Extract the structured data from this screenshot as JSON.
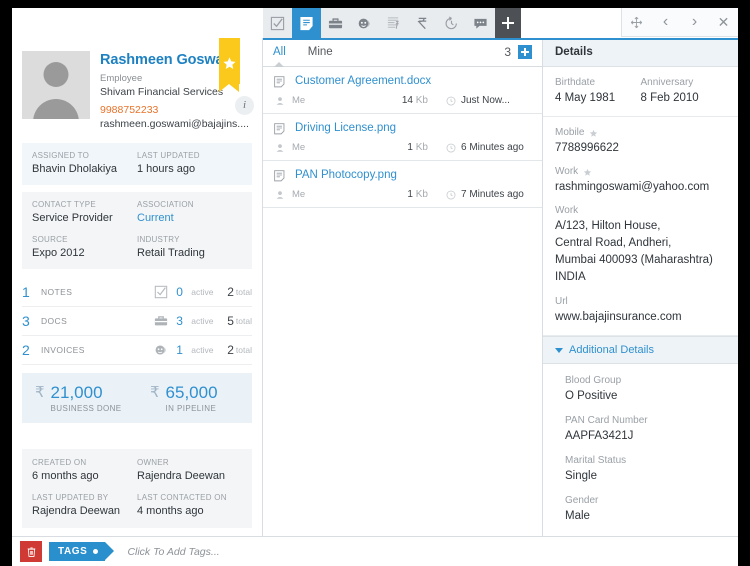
{
  "window_controls": [
    {
      "name": "move",
      "glyph": "move-icon"
    },
    {
      "name": "previous",
      "glyph": "‹"
    },
    {
      "name": "next",
      "glyph": "›"
    },
    {
      "name": "close",
      "glyph": "✕"
    }
  ],
  "toolbar": {
    "items": [
      {
        "name": "tasks-icon",
        "active": false
      },
      {
        "name": "notes-icon",
        "active": true
      },
      {
        "name": "deals-icon",
        "active": false
      },
      {
        "name": "contacts-icon",
        "active": false
      },
      {
        "name": "invoices-icon",
        "active": false
      },
      {
        "name": "payments-icon",
        "active": false
      },
      {
        "name": "history-icon",
        "active": false
      },
      {
        "name": "comments-icon",
        "active": false
      }
    ],
    "add_label": "+"
  },
  "profile": {
    "name": "Rashmeen Goswami",
    "role": "Employee",
    "company": "Shivam Financial Services",
    "phone": "9988752233",
    "email": "rashmeen.goswami@bajajins....",
    "favorite_icon": "star-icon",
    "info_icon": "info-icon"
  },
  "assigned_block": {
    "assigned_to_label": "ASSIGNED TO",
    "assigned_to_value": "Bhavin Dholakiya",
    "last_updated_label": "LAST UPDATED",
    "last_updated_value": "1 hours ago"
  },
  "contact_block": {
    "contact_type_label": "CONTACT TYPE",
    "contact_type_value": "Service Provider",
    "association_label": "ASSOCIATION",
    "association_value": "Current",
    "source_label": "SOURCE",
    "source_value": "Expo 2012",
    "industry_label": "INDUSTRY",
    "industry_value": "Retail Trading"
  },
  "stats": [
    {
      "count": "1",
      "label": "NOTES",
      "icon": "tasks-icon",
      "active": "0",
      "active_label": "active",
      "total": "2",
      "total_label": "total"
    },
    {
      "count": "3",
      "label": "DOCS",
      "icon": "deals-icon",
      "active": "3",
      "active_label": "active",
      "total": "5",
      "total_label": "total"
    },
    {
      "count": "2",
      "label": "INVOICES",
      "icon": "contacts-icon",
      "active": "1",
      "active_label": "active",
      "total": "2",
      "total_label": "total"
    }
  ],
  "money": [
    {
      "currency": "₹",
      "value": "21,000",
      "caption": "BUSINESS DONE"
    },
    {
      "currency": "₹",
      "value": "65,000",
      "caption": "IN PIPELINE"
    }
  ],
  "footer_meta": {
    "created_on_label": "CREATED ON",
    "created_on_value": "6 months ago",
    "owner_label": "OWNER",
    "owner_value": "Rajendra Deewan",
    "last_updated_by_label": "LAST UPDATED BY",
    "last_updated_by_value": "Rajendra Deewan",
    "last_contacted_on_label": "LAST CONTACTED ON",
    "last_contacted_on_value": "4 months ago"
  },
  "docs_panel": {
    "tab_all": "All",
    "tab_mine": "Mine",
    "count": "3",
    "add_label": "+",
    "rows": [
      {
        "name": "Customer Agreement.docx",
        "owner": "Me",
        "size": "14",
        "size_unit": "Kb",
        "time": "Just Now..."
      },
      {
        "name": "Driving License.png",
        "owner": "Me",
        "size": "1",
        "size_unit": "Kb",
        "time": "6 Minutes ago"
      },
      {
        "name": "PAN Photocopy.png",
        "owner": "Me",
        "size": "1",
        "size_unit": "Kb",
        "time": "7 Minutes ago"
      }
    ]
  },
  "details": {
    "title": "Details",
    "birthdate_label": "Birthdate",
    "birthdate_value": "4 May 1981",
    "anniversary_label": "Anniversary",
    "anniversary_value": "8 Feb 2010",
    "mobile_label": "Mobile",
    "mobile_value": "7788996622",
    "work_email_label": "Work",
    "work_email_value": "rashmingoswami@yahoo.com",
    "work_address_label": "Work",
    "work_address_line1": "A/123, Hilton House,",
    "work_address_line2": "Central Road, Andheri,",
    "work_address_line3": "Mumbai 400093 (Maharashtra) INDIA",
    "url_label": "Url",
    "url_value": "www.bajajinsurance.com",
    "additional_title": "Additional Details",
    "additional": [
      {
        "label": "Blood Group",
        "value": "O Positive"
      },
      {
        "label": "PAN Card Number",
        "value": "AAPFA3421J"
      },
      {
        "label": "Marital Status",
        "value": "Single"
      },
      {
        "label": "Gender",
        "value": "Male"
      }
    ]
  },
  "tags_bar": {
    "delete_icon": "trash-icon",
    "tags_label": "TAGS",
    "placeholder": "Click To Add Tags..."
  },
  "colors": {
    "accent": "#2f90cf",
    "brand_title": "#1d81c2",
    "phone": "#e8732b",
    "ribbon": "#fbc91b",
    "danger": "#cf3a35"
  }
}
